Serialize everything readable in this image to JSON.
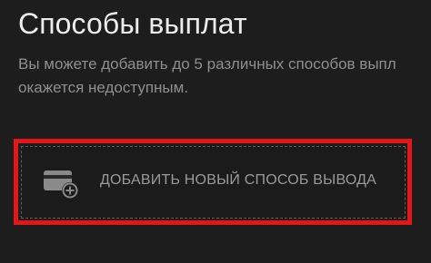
{
  "page": {
    "title": "Способы выплат",
    "description_lines": [
      "Вы можете добавить до 5 различных способов выпл",
      "окажется недоступным."
    ]
  },
  "add_method": {
    "label": "ДОБАВИТЬ НОВЫЙ СПОСОБ ВЫВОДА",
    "icon": "card-add-icon"
  },
  "colors": {
    "background": "#1d1d1d",
    "highlight": "#e31717",
    "text_primary": "#ececec",
    "text_secondary": "#8f8f8f"
  }
}
